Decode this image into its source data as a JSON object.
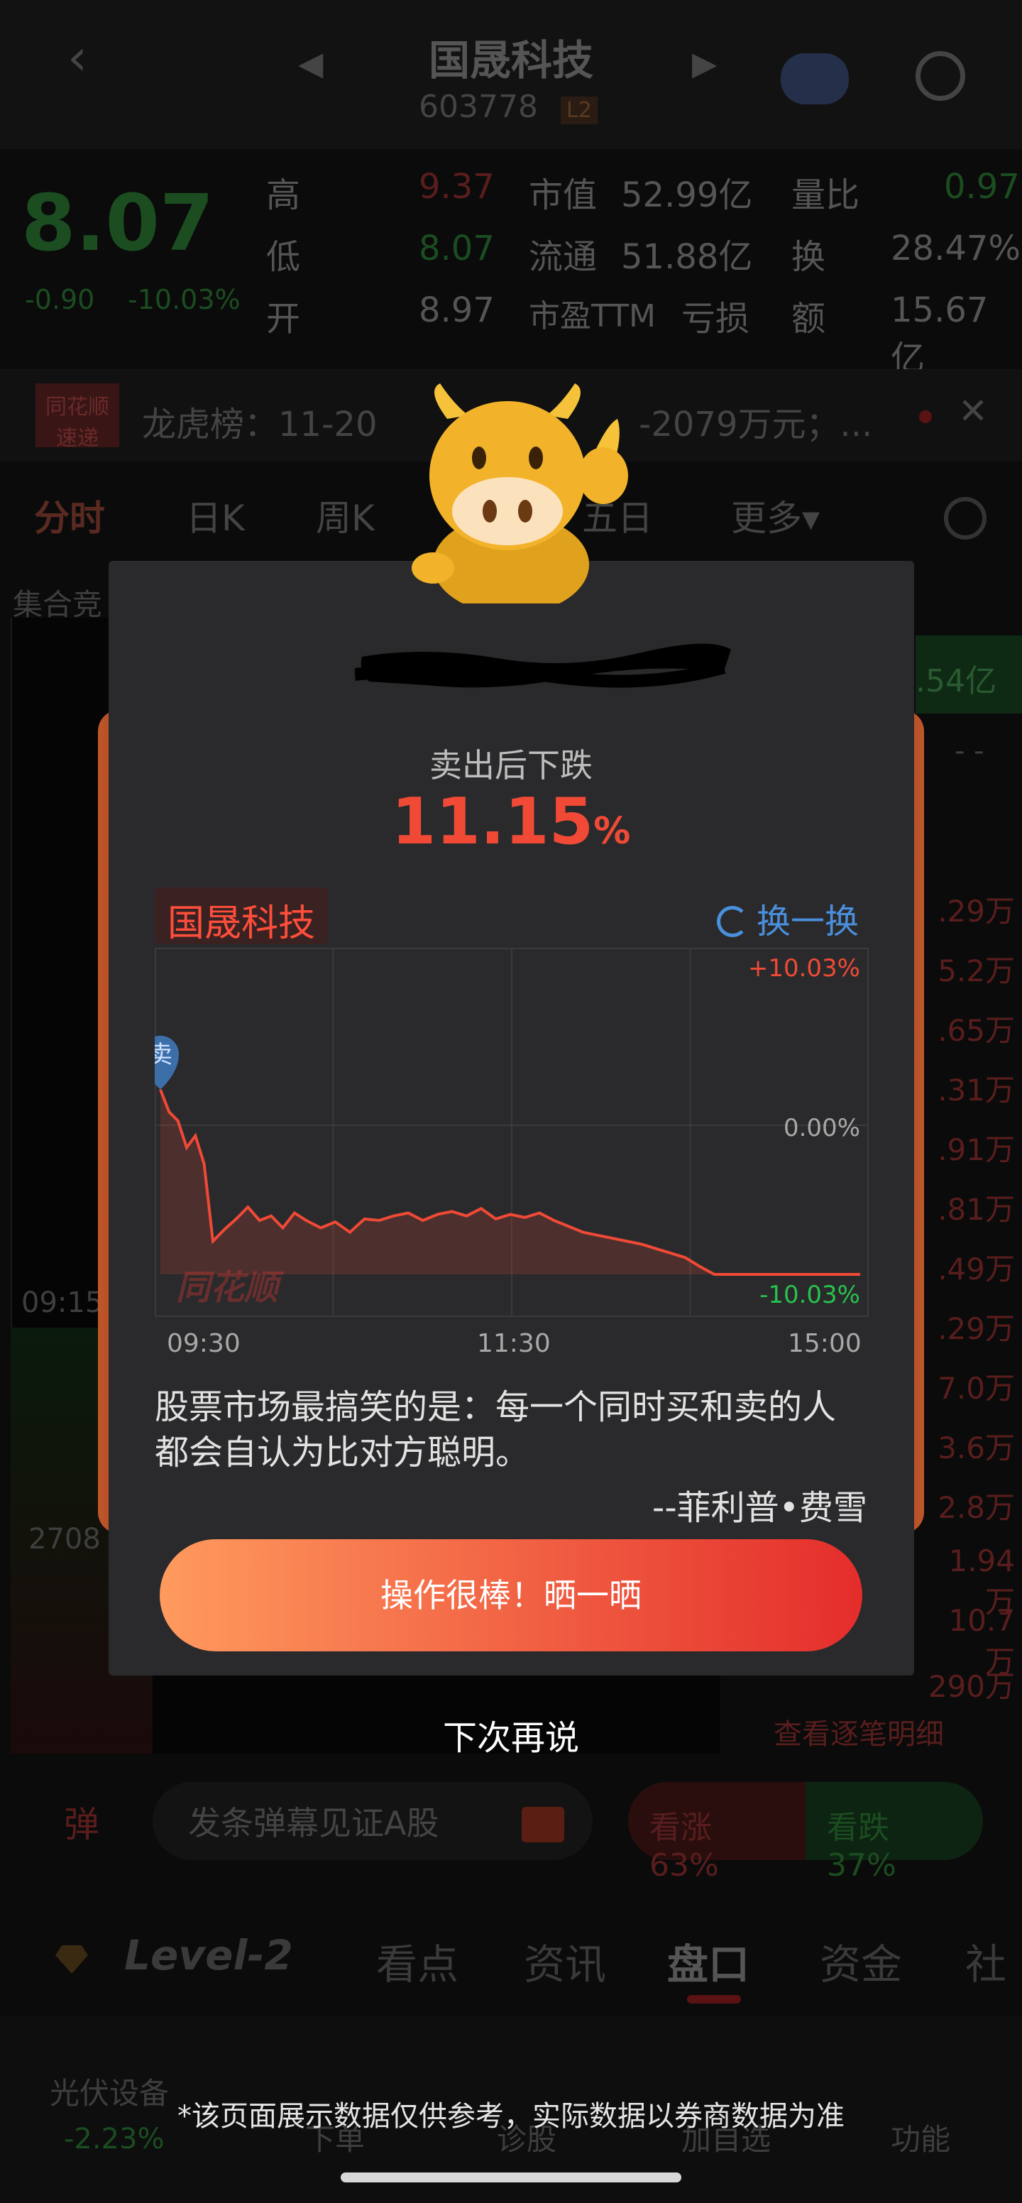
{
  "header": {
    "title": "国晟科技",
    "code": "603778",
    "level_badge": "L2"
  },
  "quote": {
    "price": "8.07",
    "change": "-0.90",
    "change_pct": "-10.03%",
    "rows": [
      {
        "label": "高",
        "value": "9.37",
        "label2": "市值",
        "value2": "52.99亿",
        "label3": "量比",
        "value3": "0.97"
      },
      {
        "label": "低",
        "value": "8.07",
        "label2": "流通",
        "value2": "51.88亿",
        "label3": "换",
        "value3": "28.47%"
      },
      {
        "label": "开",
        "value": "8.97",
        "label2": "市盈TTM",
        "value2": "亏损",
        "label3": "额",
        "value3": "15.67亿"
      }
    ]
  },
  "banner": {
    "brand": "同花顺 速递",
    "text": "龙虎榜：11-20",
    "text_tail": "-2079万元；..."
  },
  "chart_tabs": [
    "分时",
    "日K",
    "周K",
    "五日",
    "更多▾"
  ],
  "left_labels": {
    "auction": "集合竞",
    "time": "09:15",
    "volume": "2708"
  },
  "right_side": {
    "top_value": ".54亿",
    "top_dash": "- -",
    "values": [
      ".29万",
      "5.2万",
      ".65万",
      ".31万",
      ".91万",
      ".81万",
      ".49万",
      ".29万",
      "7.0万",
      "3.6万",
      "2.8万",
      "1.94万",
      "10.7万",
      "290万"
    ],
    "detail_link": "查看逐笔明细"
  },
  "bottom_area": {
    "danmu_icon": "弹",
    "danmu_placeholder": "发条弹幕见证A股",
    "bull": "看涨 63%",
    "bear": "看跌 37%",
    "tabs": [
      "Level-2",
      "看点",
      "资讯",
      "盘口",
      "资金",
      "社"
    ],
    "sector_name": "光伏设备",
    "sector_change": "-2.23%",
    "toolbar": [
      "下单",
      "诊股",
      "加自选",
      "功能"
    ]
  },
  "modal": {
    "subtitle": "卖出后下跌",
    "pct_value": "11.15",
    "pct_unit": "%",
    "stock_name": "国晟科技",
    "swap_label": "换一换",
    "sell_marker": "卖",
    "watermark": "同花顺",
    "quote_text": "股票市场最搞笑的是：每一个同时买和卖的人都会自认为比对方聪明。",
    "quote_author": "--菲利普•费雪",
    "share_button": "操作很棒！晒一晒",
    "later_link": "下次再说"
  },
  "disclaimer": "*该页面展示数据仅供参考，实际数据以券商数据为准",
  "colors": {
    "up": "#f04a36",
    "down": "#27c24c",
    "accent": "#4a8fdb"
  },
  "chart_data": {
    "type": "line",
    "x_ticks": [
      "09:30",
      "11:30",
      "15:00"
    ],
    "y_ticks": [
      "+10.03%",
      "0.00%",
      "-10.03%"
    ],
    "ylim": [
      -10.03,
      10.03
    ],
    "series": [
      {
        "x": [
          0,
          3,
          6,
          9,
          12,
          15,
          18,
          22,
          26,
          30,
          34,
          38,
          42,
          46,
          50,
          55,
          60,
          65,
          70,
          75,
          80,
          85,
          90,
          95,
          100,
          105,
          110,
          115,
          120,
          125,
          130,
          135,
          140,
          145,
          150,
          155,
          160,
          165,
          170,
          175,
          180,
          185,
          190,
          195,
          200,
          205,
          210,
          215,
          220,
          225,
          230,
          235,
          240
        ],
        "y": [
          2.4,
          0.9,
          0.3,
          -1.5,
          -0.7,
          -2.6,
          -7.8,
          -7.0,
          -6.3,
          -5.5,
          -6.4,
          -6.1,
          -6.9,
          -5.9,
          -6.4,
          -6.9,
          -6.5,
          -7.2,
          -6.3,
          -6.4,
          -6.1,
          -5.9,
          -6.4,
          -6.0,
          -5.8,
          -6.1,
          -5.6,
          -6.3,
          -6.0,
          -6.2,
          -5.9,
          -6.4,
          -6.8,
          -7.2,
          -7.4,
          -7.6,
          -7.8,
          -8.0,
          -8.3,
          -8.6,
          -8.9,
          -9.5,
          -10.03,
          -10.03,
          -10.03,
          -10.03,
          -10.03,
          -10.03,
          -10.03,
          -10.03,
          -10.03,
          -10.03,
          -10.03
        ]
      }
    ]
  }
}
